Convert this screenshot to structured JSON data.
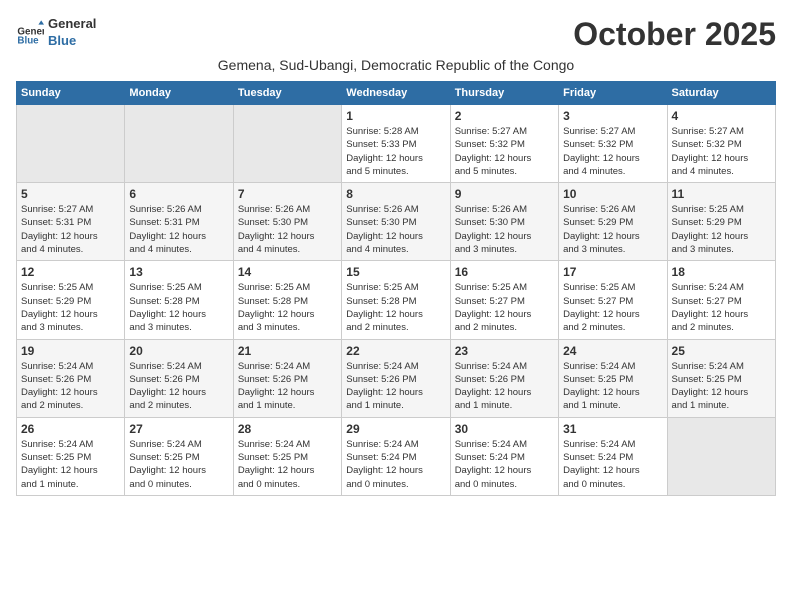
{
  "logo": {
    "line1": "General",
    "line2": "Blue"
  },
  "title": "October 2025",
  "subtitle": "Gemena, Sud-Ubangi, Democratic Republic of the Congo",
  "headers": [
    "Sunday",
    "Monday",
    "Tuesday",
    "Wednesday",
    "Thursday",
    "Friday",
    "Saturday"
  ],
  "weeks": [
    [
      {
        "day": "",
        "info": ""
      },
      {
        "day": "",
        "info": ""
      },
      {
        "day": "",
        "info": ""
      },
      {
        "day": "1",
        "info": "Sunrise: 5:28 AM\nSunset: 5:33 PM\nDaylight: 12 hours\nand 5 minutes."
      },
      {
        "day": "2",
        "info": "Sunrise: 5:27 AM\nSunset: 5:32 PM\nDaylight: 12 hours\nand 5 minutes."
      },
      {
        "day": "3",
        "info": "Sunrise: 5:27 AM\nSunset: 5:32 PM\nDaylight: 12 hours\nand 4 minutes."
      },
      {
        "day": "4",
        "info": "Sunrise: 5:27 AM\nSunset: 5:32 PM\nDaylight: 12 hours\nand 4 minutes."
      }
    ],
    [
      {
        "day": "5",
        "info": "Sunrise: 5:27 AM\nSunset: 5:31 PM\nDaylight: 12 hours\nand 4 minutes."
      },
      {
        "day": "6",
        "info": "Sunrise: 5:26 AM\nSunset: 5:31 PM\nDaylight: 12 hours\nand 4 minutes."
      },
      {
        "day": "7",
        "info": "Sunrise: 5:26 AM\nSunset: 5:30 PM\nDaylight: 12 hours\nand 4 minutes."
      },
      {
        "day": "8",
        "info": "Sunrise: 5:26 AM\nSunset: 5:30 PM\nDaylight: 12 hours\nand 4 minutes."
      },
      {
        "day": "9",
        "info": "Sunrise: 5:26 AM\nSunset: 5:30 PM\nDaylight: 12 hours\nand 3 minutes."
      },
      {
        "day": "10",
        "info": "Sunrise: 5:26 AM\nSunset: 5:29 PM\nDaylight: 12 hours\nand 3 minutes."
      },
      {
        "day": "11",
        "info": "Sunrise: 5:25 AM\nSunset: 5:29 PM\nDaylight: 12 hours\nand 3 minutes."
      }
    ],
    [
      {
        "day": "12",
        "info": "Sunrise: 5:25 AM\nSunset: 5:29 PM\nDaylight: 12 hours\nand 3 minutes."
      },
      {
        "day": "13",
        "info": "Sunrise: 5:25 AM\nSunset: 5:28 PM\nDaylight: 12 hours\nand 3 minutes."
      },
      {
        "day": "14",
        "info": "Sunrise: 5:25 AM\nSunset: 5:28 PM\nDaylight: 12 hours\nand 3 minutes."
      },
      {
        "day": "15",
        "info": "Sunrise: 5:25 AM\nSunset: 5:28 PM\nDaylight: 12 hours\nand 2 minutes."
      },
      {
        "day": "16",
        "info": "Sunrise: 5:25 AM\nSunset: 5:27 PM\nDaylight: 12 hours\nand 2 minutes."
      },
      {
        "day": "17",
        "info": "Sunrise: 5:25 AM\nSunset: 5:27 PM\nDaylight: 12 hours\nand 2 minutes."
      },
      {
        "day": "18",
        "info": "Sunrise: 5:24 AM\nSunset: 5:27 PM\nDaylight: 12 hours\nand 2 minutes."
      }
    ],
    [
      {
        "day": "19",
        "info": "Sunrise: 5:24 AM\nSunset: 5:26 PM\nDaylight: 12 hours\nand 2 minutes."
      },
      {
        "day": "20",
        "info": "Sunrise: 5:24 AM\nSunset: 5:26 PM\nDaylight: 12 hours\nand 2 minutes."
      },
      {
        "day": "21",
        "info": "Sunrise: 5:24 AM\nSunset: 5:26 PM\nDaylight: 12 hours\nand 1 minute."
      },
      {
        "day": "22",
        "info": "Sunrise: 5:24 AM\nSunset: 5:26 PM\nDaylight: 12 hours\nand 1 minute."
      },
      {
        "day": "23",
        "info": "Sunrise: 5:24 AM\nSunset: 5:26 PM\nDaylight: 12 hours\nand 1 minute."
      },
      {
        "day": "24",
        "info": "Sunrise: 5:24 AM\nSunset: 5:25 PM\nDaylight: 12 hours\nand 1 minute."
      },
      {
        "day": "25",
        "info": "Sunrise: 5:24 AM\nSunset: 5:25 PM\nDaylight: 12 hours\nand 1 minute."
      }
    ],
    [
      {
        "day": "26",
        "info": "Sunrise: 5:24 AM\nSunset: 5:25 PM\nDaylight: 12 hours\nand 1 minute."
      },
      {
        "day": "27",
        "info": "Sunrise: 5:24 AM\nSunset: 5:25 PM\nDaylight: 12 hours\nand 0 minutes."
      },
      {
        "day": "28",
        "info": "Sunrise: 5:24 AM\nSunset: 5:25 PM\nDaylight: 12 hours\nand 0 minutes."
      },
      {
        "day": "29",
        "info": "Sunrise: 5:24 AM\nSunset: 5:24 PM\nDaylight: 12 hours\nand 0 minutes."
      },
      {
        "day": "30",
        "info": "Sunrise: 5:24 AM\nSunset: 5:24 PM\nDaylight: 12 hours\nand 0 minutes."
      },
      {
        "day": "31",
        "info": "Sunrise: 5:24 AM\nSunset: 5:24 PM\nDaylight: 12 hours\nand 0 minutes."
      },
      {
        "day": "",
        "info": ""
      }
    ]
  ]
}
